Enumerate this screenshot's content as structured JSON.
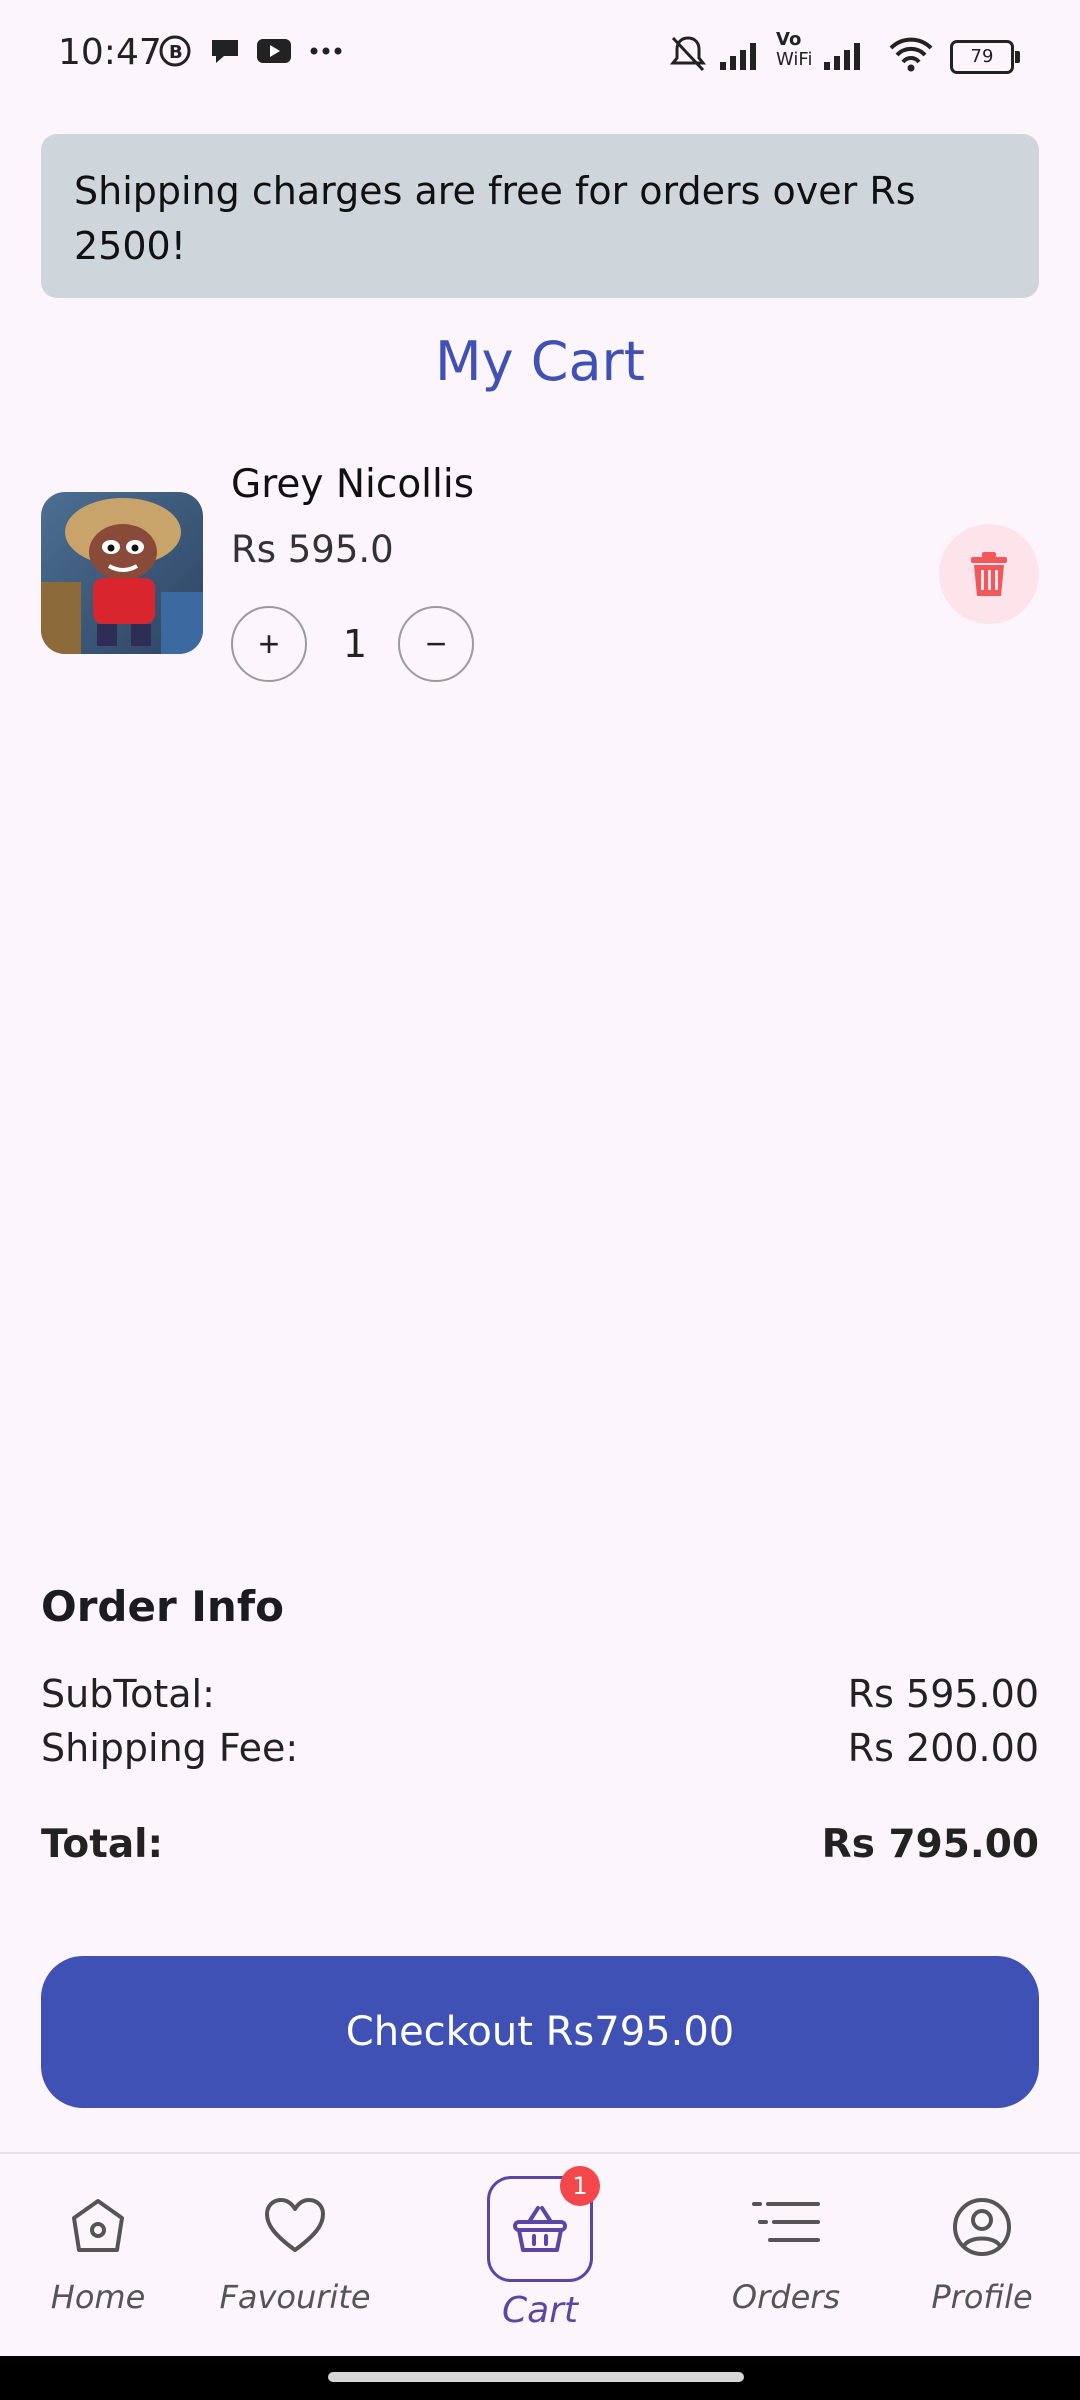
{
  "status_bar": {
    "time": "10:47",
    "battery": "79",
    "icons": [
      "b-icon",
      "chat-icon",
      "youtube-icon",
      "more-icon",
      "mute-icon",
      "signal-icon",
      "vowifi-icon",
      "signal-icon",
      "wifi-icon",
      "battery-icon"
    ],
    "vowifi_top": "Vo",
    "vowifi_bottom": "WiFi"
  },
  "banner": {
    "text": "Shipping charges are free for orders over Rs 2500!"
  },
  "page_title": "My Cart",
  "cart_item": {
    "name": "Grey Nicollis",
    "price": "Rs 595.0",
    "quantity": "1",
    "increase_symbol": "+",
    "decrease_symbol": "−"
  },
  "order_info": {
    "title": "Order Info",
    "subtotal_label": "SubTotal:",
    "subtotal_value": "Rs 595.00",
    "shipping_label": "Shipping Fee:",
    "shipping_value": "Rs 200.00",
    "total_label": "Total:",
    "total_value": "Rs 795.00"
  },
  "checkout_label": "Checkout Rs795.00",
  "bottom_nav": {
    "home": "Home",
    "favourite": "Favourite",
    "cart": "Cart",
    "cart_badge": "1",
    "orders": "Orders",
    "profile": "Profile"
  },
  "colors": {
    "accent": "#3f51b5",
    "banner_bg": "#cfd6db",
    "delete_bg": "#fce4ea",
    "delete_icon": "#f2575a",
    "badge": "#f4474b",
    "nav_active": "#5b46a5"
  }
}
